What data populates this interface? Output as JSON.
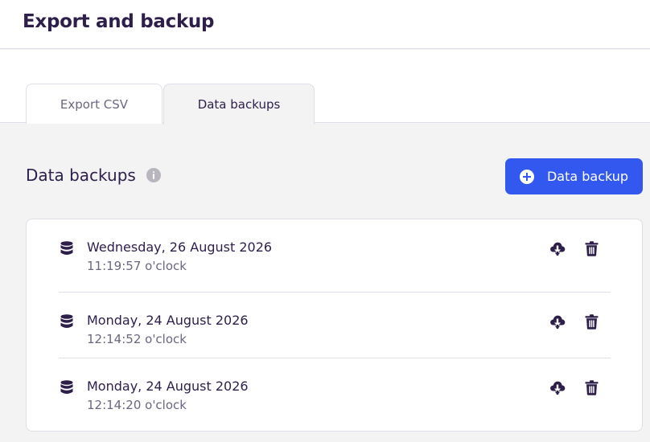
{
  "header": {
    "title": "Export and backup"
  },
  "tabs": [
    {
      "label": "Export CSV",
      "active": false
    },
    {
      "label": "Data backups",
      "active": true
    }
  ],
  "section": {
    "title": "Data backups",
    "info_icon": "info-icon",
    "add_button_label": "Data backup",
    "add_button_icon": "plus-circle-icon"
  },
  "backups": [
    {
      "date": "Wednesday, 26 August 2026",
      "time": "11:19:57 o'clock"
    },
    {
      "date": "Monday, 24 August 2026",
      "time": "12:14:52 o'clock"
    },
    {
      "date": "Monday, 24 August 2026",
      "time": "12:14:20 o'clock"
    }
  ],
  "icons": {
    "row": "database-icon",
    "download": "cloud-download-icon",
    "delete": "trash-icon"
  },
  "colors": {
    "accent": "#3358f0",
    "text": "#2d1e4a",
    "muted": "#6c6680",
    "background": "#f3f3f3"
  }
}
